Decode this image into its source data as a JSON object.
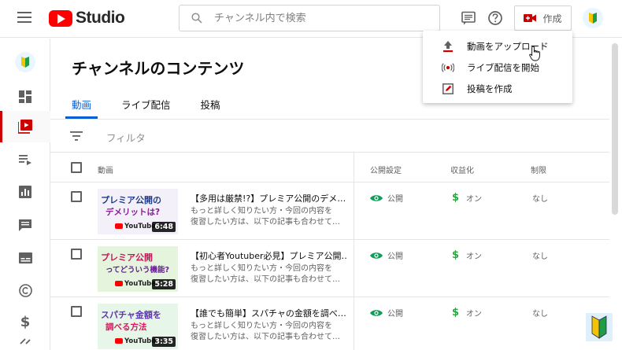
{
  "header": {
    "logo_text": "Studio",
    "search_placeholder": "チャンネル内で検索",
    "create_label": "作成"
  },
  "sidebar": {
    "items": [
      {
        "icon": "dashboard-icon"
      },
      {
        "icon": "content-icon",
        "active": true
      },
      {
        "icon": "playlists-icon"
      },
      {
        "icon": "analytics-icon"
      },
      {
        "icon": "comments-icon"
      },
      {
        "icon": "subtitles-icon"
      },
      {
        "icon": "copyright-icon"
      },
      {
        "icon": "monetization-icon"
      }
    ]
  },
  "main": {
    "title": "チャンネルのコンテンツ",
    "tabs": [
      {
        "label": "動画",
        "active": true
      },
      {
        "label": "ライブ配信"
      },
      {
        "label": "投稿"
      }
    ],
    "filter_label": "フィルタ",
    "columns": {
      "video": "動画",
      "visibility": "公開設定",
      "monetization": "収益化",
      "restrictions": "制限"
    },
    "videos": [
      {
        "title": "【多用は厳禁!?】プレミア公開のデメ…",
        "desc_line1": "もっと詳しく知りたい方・今回の内容を",
        "desc_line2": "復習したい方は、以下の記事も合わせて…",
        "visibility": "公開",
        "monetization": "オン",
        "restrictions": "なし",
        "thumb_line1": "プレミア公開の",
        "thumb_line2": "デメリットは?",
        "thumb_channel": "YouTube",
        "duration": "6:48"
      },
      {
        "title": "【初心者Youtuber必見】プレミア公開…",
        "desc_line1": "もっと詳しく知りたい方・今回の内容を",
        "desc_line2": "復習したい方は、以下の記事も合わせて…",
        "visibility": "公開",
        "monetization": "オン",
        "restrictions": "なし",
        "thumb_line1": "プレミア公開",
        "thumb_line2": "ってどういう機能?",
        "thumb_channel": "YouTube",
        "duration": "5:28"
      },
      {
        "title": "【誰でも簡単】スパチャの金額を調べ…",
        "desc_line1": "もっと詳しく知りたい方・今回の内容を",
        "desc_line2": "復習したい方は、以下の記事も合わせて…",
        "visibility": "公開",
        "monetization": "オン",
        "restrictions": "なし",
        "thumb_line1": "スパチャ金額を",
        "thumb_line2": "調べる方法",
        "thumb_channel": "YouTube",
        "duration": "3:35"
      }
    ]
  },
  "create_menu": {
    "items": [
      {
        "label": "動画をアップロード",
        "icon": "upload-icon"
      },
      {
        "label": "ライブ配信を開始",
        "icon": "live-icon"
      },
      {
        "label": "投稿を作成",
        "icon": "edit-post-icon"
      }
    ]
  },
  "colors": {
    "brand_red": "#ff0000",
    "accent_blue": "#065fd4",
    "monetization_green": "#2ba640",
    "visibility_green": "#0f9d58"
  }
}
